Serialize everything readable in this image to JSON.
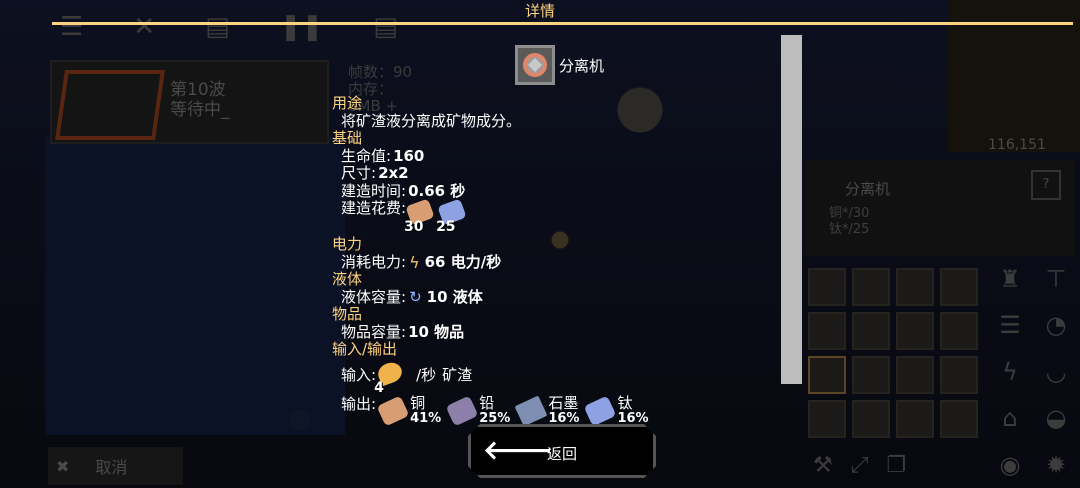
{
  "dialog": {
    "title": "详情",
    "block_name": "分离机",
    "sections": {
      "usage": {
        "label": "用途",
        "text": "将矿渣液分离成矿物成分。"
      },
      "general": {
        "label": "基础",
        "health_label": "生命值:",
        "health": "160",
        "size_label": "尺寸:",
        "size": "2x2",
        "build_time_label": "建造时间:",
        "build_time": "0.66 秒",
        "build_cost_label": "建造花费:",
        "build_cost": [
          {
            "item": "copper",
            "amount": "30",
            "color": "#d99d73"
          },
          {
            "item": "titanium",
            "amount": "25",
            "color": "#8da1e3"
          }
        ]
      },
      "power": {
        "label": "电力",
        "use_label": "消耗电力:",
        "use": "66 电力/秒",
        "icon": "lightning-icon"
      },
      "liquid": {
        "label": "液体",
        "capacity_label": "液体容量:",
        "capacity": "10 液体",
        "icon": "liquid-icon"
      },
      "items": {
        "label": "物品",
        "capacity_label": "物品容量:",
        "capacity": "10 物品"
      },
      "io": {
        "label": "输入/输出",
        "input_label": "输入:",
        "input_amount": "4",
        "input_rate": "/秒",
        "input_name": "矿渣",
        "output_label": "输出:",
        "outputs": [
          {
            "name": "铜",
            "percent": "41%",
            "color": "#d99d73"
          },
          {
            "name": "铅",
            "percent": "25%",
            "color": "#8c7fa9"
          },
          {
            "name": "石墨",
            "percent": "16%",
            "color": "#7f8fb3"
          },
          {
            "name": "钛",
            "percent": "16%",
            "color": "#8da1e3"
          }
        ]
      }
    },
    "back_button": "返回"
  },
  "background": {
    "wave_title": "第10波",
    "wave_status": "等待中_",
    "stats_fps": "帧数：90",
    "stats_memory": "内存：",
    "stats_mb": "6MB +",
    "coords": "116,151",
    "info_block_name": "分离机",
    "info_req_copper": "铜*/30",
    "info_req_titanium": "钛*/25",
    "info_help": "?",
    "cancel_label": "取消"
  }
}
